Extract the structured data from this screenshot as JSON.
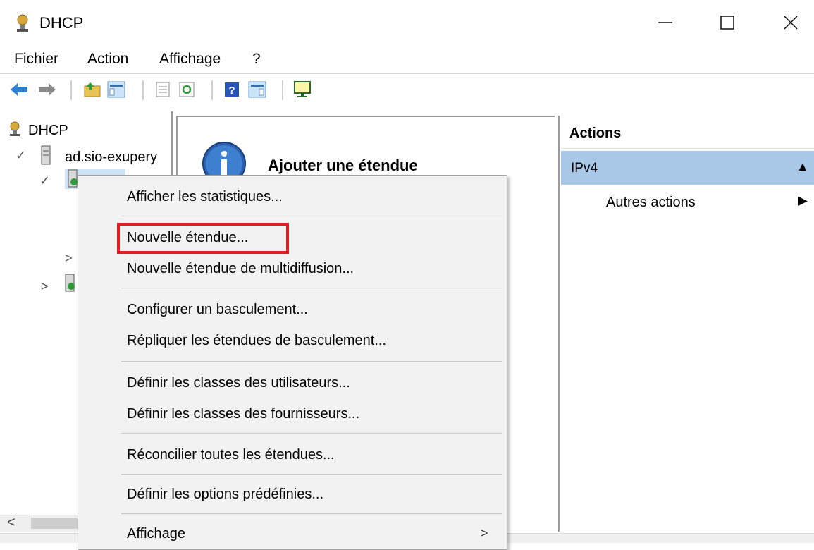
{
  "window": {
    "title": "DHCP"
  },
  "menubar": {
    "items": [
      "Fichier",
      "Action",
      "Affichage",
      "?"
    ]
  },
  "tree": {
    "root": "DHCP",
    "server": "ad.sio-exupery"
  },
  "result": {
    "info_title": "Ajouter une étendue"
  },
  "actions": {
    "title": "Actions",
    "section": "IPv4",
    "more": "Autres actions"
  },
  "context_menu": {
    "items": [
      "Afficher les statistiques...",
      "Nouvelle étendue...",
      "Nouvelle étendue de multidiffusion...",
      "Configurer un basculement...",
      "Répliquer les étendues de basculement...",
      "Définir les classes des utilisateurs...",
      "Définir les classes des fournisseurs...",
      "Réconcilier toutes les étendues...",
      "Définir les options prédéfinies...",
      "Affichage"
    ],
    "highlighted_item": "Nouvelle étendue..."
  },
  "colors": {
    "highlight_border": "#e01f25",
    "selection_bg": "#a9c7e6",
    "menu_bg": "#f2f2f2"
  },
  "icons": {
    "app": "dhcp-icon",
    "back": "back-arrow-icon",
    "forward": "forward-arrow-icon",
    "info": "info-icon"
  }
}
